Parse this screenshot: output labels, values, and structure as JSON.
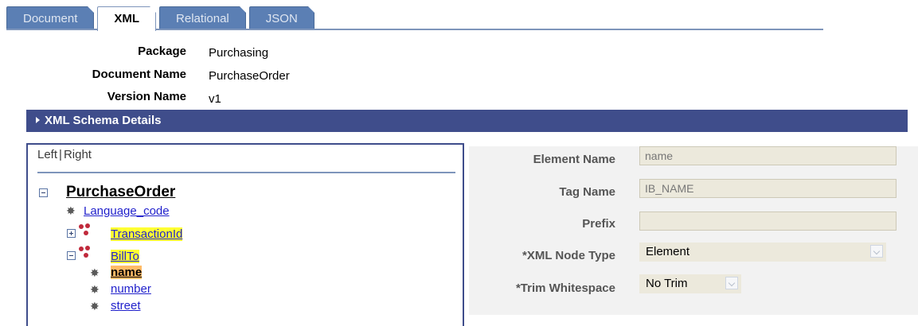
{
  "tabs": [
    {
      "label": "Document",
      "active": false
    },
    {
      "label": "XML",
      "active": true
    },
    {
      "label": "Relational",
      "active": false
    },
    {
      "label": "JSON",
      "active": false
    }
  ],
  "header": {
    "package_label": "Package",
    "package_value": "Purchasing",
    "document_name_label": "Document Name",
    "document_name_value": "PurchaseOrder",
    "version_name_label": "Version Name",
    "version_name_value": "v1"
  },
  "section": {
    "title": "XML Schema Details"
  },
  "tree": {
    "left_link": "Left",
    "separator": "|",
    "right_link": "Right",
    "root": "PurchaseOrder",
    "nodes": [
      {
        "label": "Language_code",
        "type": "element",
        "highlight": "none"
      },
      {
        "label": "TransactionId",
        "type": "complex",
        "expanded": false,
        "highlight": "yellow"
      },
      {
        "label": "BillTo",
        "type": "complex",
        "expanded": true,
        "highlight": "yellow"
      },
      {
        "label": "name",
        "type": "element",
        "highlight": "orange",
        "selected": true
      },
      {
        "label": "number",
        "type": "element",
        "highlight": "none"
      },
      {
        "label": "street",
        "type": "element",
        "highlight": "none"
      }
    ]
  },
  "properties": {
    "element_name_label": "Element Name",
    "element_name_value": "name",
    "tag_name_label": "Tag Name",
    "tag_name_value": "IB_NAME",
    "prefix_label": "Prefix",
    "prefix_value": "",
    "xml_node_type_label": "*XML Node Type",
    "xml_node_type_value": "Element",
    "trim_whitespace_label": "*Trim Whitespace",
    "trim_whitespace_value": "No Trim"
  },
  "colors": {
    "tab_bg": "#5b7fb4",
    "section_bar": "#3f4d8b",
    "highlight_yellow": "#ffff33",
    "highlight_orange": "#ffbb66",
    "link": "#2222cc"
  }
}
